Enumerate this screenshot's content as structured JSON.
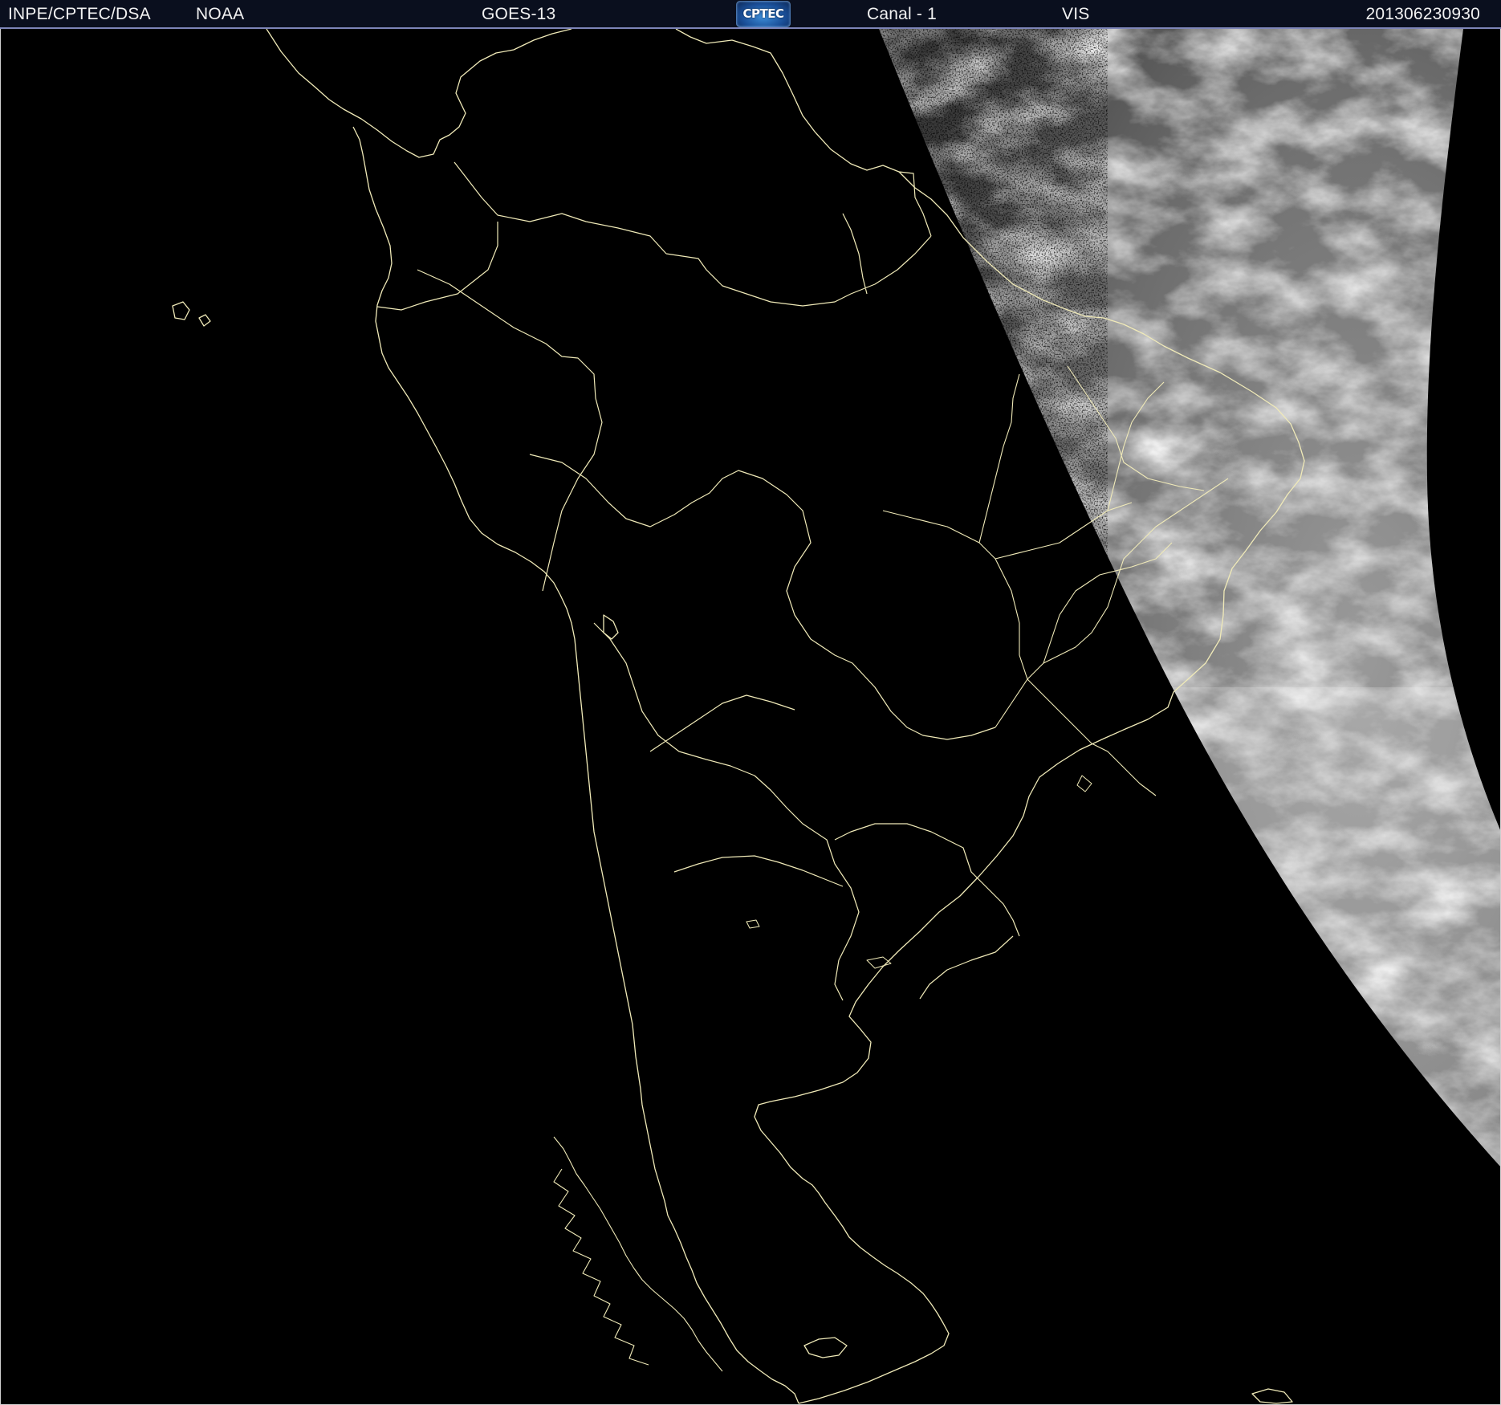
{
  "header": {
    "institution": "INPE/CPTEC/DSA",
    "agency": "NOAA",
    "satellite": "GOES-13",
    "logo_text": "CPTEC",
    "channel": "Canal - 1",
    "band": "VIS",
    "timestamp": "201306230930"
  },
  "colors": {
    "background": "#000000",
    "header_background": "#0a0f1e",
    "header_text": "#f2f2f2",
    "boundary_lines": "#f0eab8",
    "cloud_field": "#d9d9d9"
  },
  "icons": {
    "logo": "cptec-logo"
  }
}
